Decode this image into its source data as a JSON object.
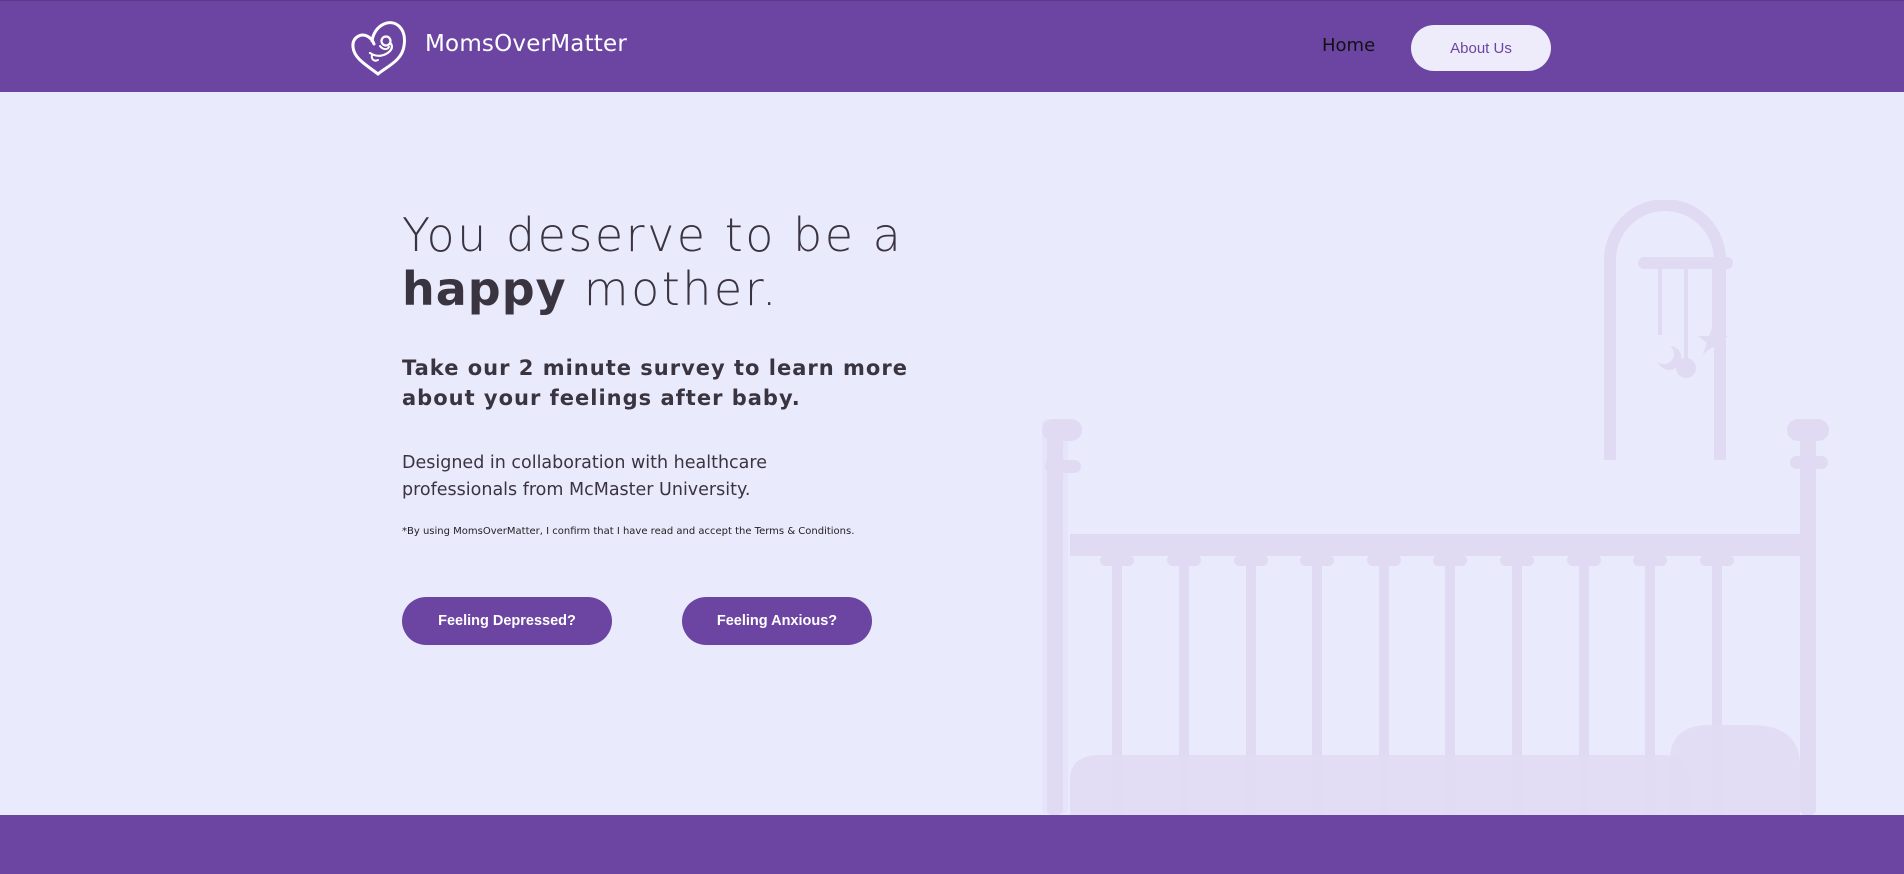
{
  "header": {
    "brand": "MomsOverMatter",
    "logo_icon": "heart-baby-logo-icon",
    "nav": {
      "home": "Home",
      "about": "About Us"
    }
  },
  "hero": {
    "headline_line1": "You deserve to be a",
    "headline_bold": "happy",
    "headline_rest": " mother.",
    "subheading": "Take our 2 minute survey to learn more about your feelings after baby.",
    "designed": "Designed in collaboration with healthcare professionals from McMaster University.",
    "terms": "*By using MomsOverMatter, I confirm that I have read and accept the Terms & Conditions.",
    "buttons": {
      "depressed": "Feeling Depressed?",
      "anxious": "Feeling Anxious?"
    }
  },
  "decor": {
    "illustration_icon": "crib-illustration-icon"
  },
  "colors": {
    "brand": "#6b45a1",
    "background": "#eaeafd",
    "pill_bg": "#eeebfb",
    "text": "#3a3440",
    "crib": "#e0daf3"
  }
}
